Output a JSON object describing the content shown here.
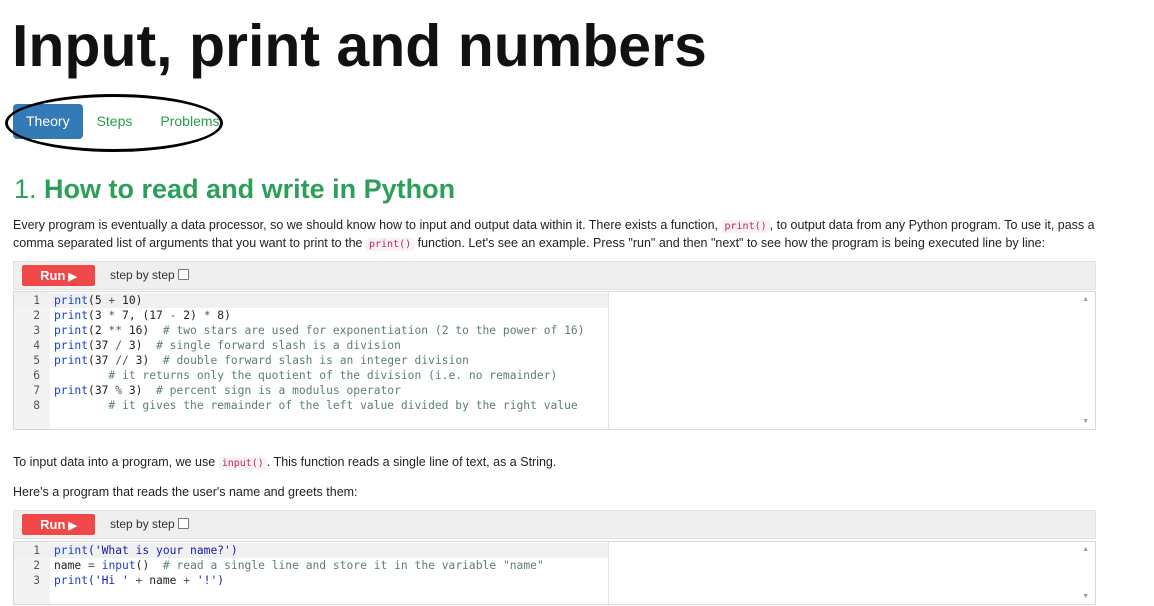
{
  "page": {
    "title": "Input, print and numbers",
    "tabs": [
      {
        "label": "Theory",
        "active": true
      },
      {
        "label": "Steps",
        "active": false
      },
      {
        "label": "Problems",
        "active": false
      }
    ]
  },
  "section": {
    "number": "1.",
    "title": "How to read and write in Python"
  },
  "intro": {
    "part1": "Every program is eventually a data processor, so we should know how to input and output data within it. There exists a function, ",
    "code1": "print()",
    "part2": ", to output data from any Python program. To use it, pass a comma separated list of arguments that you want to print to the ",
    "code2": "print()",
    "part3": " function. Let's see an example. Press \"run\" and then \"next\" to see how the program is being executed line by line:"
  },
  "input_para": {
    "part1": "To input data into a program, we use ",
    "code": "input()",
    "part2": ". This function reads a single line of text, as a String."
  },
  "greet_para": "Here's a program that reads the user's name and greets them:",
  "toolbar": {
    "run_label": "Run",
    "step_label": "step by step"
  },
  "code_block_1": {
    "lines": [
      {
        "n": "1",
        "parts": [
          [
            "kw",
            "print"
          ],
          [
            "pl",
            "(5 "
          ],
          [
            "op",
            "+"
          ],
          [
            "pl",
            " 10)"
          ]
        ]
      },
      {
        "n": "2",
        "parts": [
          [
            "kw",
            "print"
          ],
          [
            "pl",
            "(3 "
          ],
          [
            "op",
            "*"
          ],
          [
            "pl",
            " 7, (17 "
          ],
          [
            "op",
            "-"
          ],
          [
            "pl",
            " 2) "
          ],
          [
            "op",
            "*"
          ],
          [
            "pl",
            " 8)"
          ]
        ]
      },
      {
        "n": "3",
        "parts": [
          [
            "kw",
            "print"
          ],
          [
            "pl",
            "(2 "
          ],
          [
            "op",
            "**"
          ],
          [
            "pl",
            " 16)  "
          ],
          [
            "cm",
            "# two stars are used for exponentiation (2 to the power of 16)"
          ]
        ]
      },
      {
        "n": "4",
        "parts": [
          [
            "kw",
            "print"
          ],
          [
            "pl",
            "(37 "
          ],
          [
            "op",
            "/"
          ],
          [
            "pl",
            " 3)  "
          ],
          [
            "cm",
            "# single forward slash is a division"
          ]
        ]
      },
      {
        "n": "5",
        "parts": [
          [
            "kw",
            "print"
          ],
          [
            "pl",
            "(37 "
          ],
          [
            "op",
            "//"
          ],
          [
            "pl",
            " 3)  "
          ],
          [
            "cm",
            "# double forward slash is an integer division"
          ]
        ]
      },
      {
        "n": "6",
        "parts": [
          [
            "pl",
            "        "
          ],
          [
            "cm",
            "# it returns only the quotient of the division (i.e. no remainder)"
          ]
        ]
      },
      {
        "n": "7",
        "parts": [
          [
            "kw",
            "print"
          ],
          [
            "pl",
            "(37 "
          ],
          [
            "op",
            "%"
          ],
          [
            "pl",
            " 3)  "
          ],
          [
            "cm",
            "# percent sign is a modulus operator"
          ]
        ]
      },
      {
        "n": "8",
        "parts": [
          [
            "pl",
            "        "
          ],
          [
            "cm",
            "# it gives the remainder of the left value divided by the right value"
          ]
        ]
      }
    ]
  },
  "code_block_2": {
    "lines": [
      {
        "n": "1",
        "parts": [
          [
            "kw",
            "print"
          ],
          [
            "st",
            "('What is your name?')"
          ]
        ]
      },
      {
        "n": "2",
        "parts": [
          [
            "pl",
            "name "
          ],
          [
            "op",
            "="
          ],
          [
            "pl",
            " "
          ],
          [
            "kw",
            "input"
          ],
          [
            "pl",
            "()  "
          ],
          [
            "cm",
            "# read a single line and store it in the variable \"name\""
          ]
        ]
      },
      {
        "n": "3",
        "parts": [
          [
            "kw",
            "print"
          ],
          [
            "st",
            "('Hi ' "
          ],
          [
            "op",
            "+"
          ],
          [
            "pl",
            " name "
          ],
          [
            "op",
            "+"
          ],
          [
            "st",
            " '!')"
          ]
        ]
      }
    ]
  },
  "icons": {
    "play": "play-icon",
    "scroll_up": "scroll-up-arrow-icon",
    "scroll_down": "scroll-down-arrow-icon"
  },
  "colors": {
    "accent_blue": "#337ab7",
    "heading_green": "#2ca05a",
    "run_red": "#f04848",
    "inline_code": "#c7254e"
  }
}
